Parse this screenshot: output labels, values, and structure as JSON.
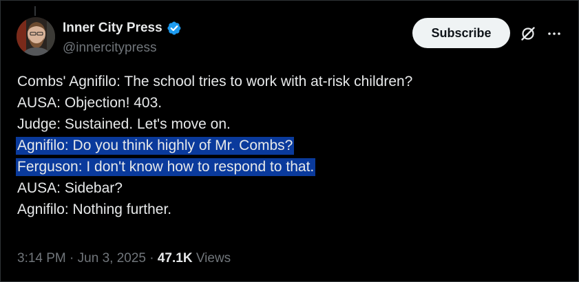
{
  "author": {
    "display_name": "Inner City Press",
    "handle": "@innercitypress",
    "verified": true
  },
  "actions": {
    "subscribe_label": "Subscribe",
    "grok_icon": "grok-icon",
    "more_icon": "more-icon"
  },
  "tweet": {
    "lines": [
      {
        "text": "Combs' Agnifilo: The school tries to work with at-risk children?",
        "highlighted": false
      },
      {
        "text": "AUSA: Objection! 403.",
        "highlighted": false
      },
      {
        "text": "Judge: Sustained. Let's move on.",
        "highlighted": false
      },
      {
        "text": "Agnifilo: Do you think highly of Mr. Combs?",
        "highlighted": true
      },
      {
        "text": "Ferguson: I don't know how to respond to that.",
        "highlighted": true
      },
      {
        "text": "AUSA: Sidebar?",
        "highlighted": false
      },
      {
        "text": "Agnifilo: Nothing further.",
        "highlighted": false
      }
    ]
  },
  "meta": {
    "time": "3:14 PM",
    "separator": " · ",
    "date": "Jun 3, 2025",
    "views_count": "47.1K",
    "views_label": "Views"
  },
  "colors": {
    "background": "#000000",
    "text": "#e7e9ea",
    "secondary": "#71767b",
    "verified": "#1d9bf0",
    "highlight": "#0a3a9c",
    "button_bg": "#eff3f4"
  }
}
